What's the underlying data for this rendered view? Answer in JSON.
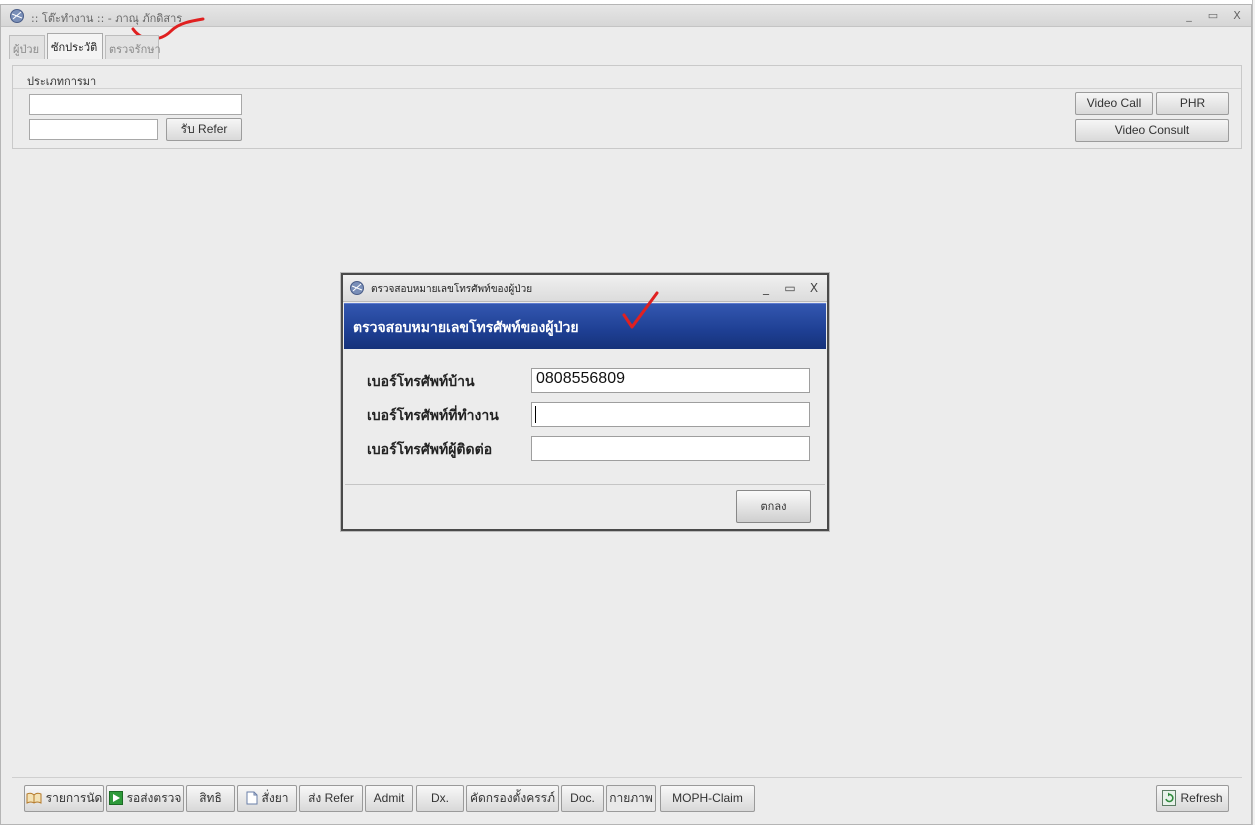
{
  "main_window": {
    "title": ":: โต๊ะทำงาน :: - ภาณุ ภักดิสาร",
    "minimize": "_",
    "maximize": "▭",
    "close": "X"
  },
  "tabs": [
    {
      "label": "ผู้ป่วย",
      "active": false
    },
    {
      "label": "ซักประวัติ",
      "active": true
    },
    {
      "label": "ตรวจรักษา",
      "active": false
    }
  ],
  "top_panel": {
    "section_label": "ประเภทการมา",
    "visit_type_value": "",
    "refer_value": "",
    "receive_refer_button": "รับ Refer",
    "video_call_button": "Video Call",
    "phr_button": "PHR",
    "video_consult_button": "Video Consult"
  },
  "dialog": {
    "window_title": "ตรวจสอบหมายเลขโทรศัพท์ของผู้ป่วย",
    "header": "ตรวจสอบหมายเลขโทรศัพท์ของผู้ป่วย",
    "minimize": "_",
    "maximize": "▭",
    "close": "X",
    "fields": [
      {
        "label": "เบอร์โทรศัพท์บ้าน",
        "value": "0808556809"
      },
      {
        "label": "เบอร์โทรศัพท์ที่ทำงาน",
        "value": ""
      },
      {
        "label": "เบอร์โทรศัพท์ผู้ติดต่อ",
        "value": ""
      }
    ],
    "ok_button": "ตกลง"
  },
  "bottom_toolbar": {
    "appointments": "รายการนัด",
    "send_to_exam": "รอส่งตรวจ",
    "rights": "สิทธิ",
    "order_drug": "สั่งยา",
    "send_refer": "ส่ง Refer",
    "admit": "Admit",
    "dx": "Dx.",
    "pregnancy_screen": "คัดกรองตั้งครรภ์",
    "doc": "Doc.",
    "physical": "กายภาพ",
    "moph_claim": "MOPH-Claim",
    "refresh": "Refresh"
  },
  "colors": {
    "dialog_header": "#1e3f93",
    "annotation_red": "#e02020"
  }
}
